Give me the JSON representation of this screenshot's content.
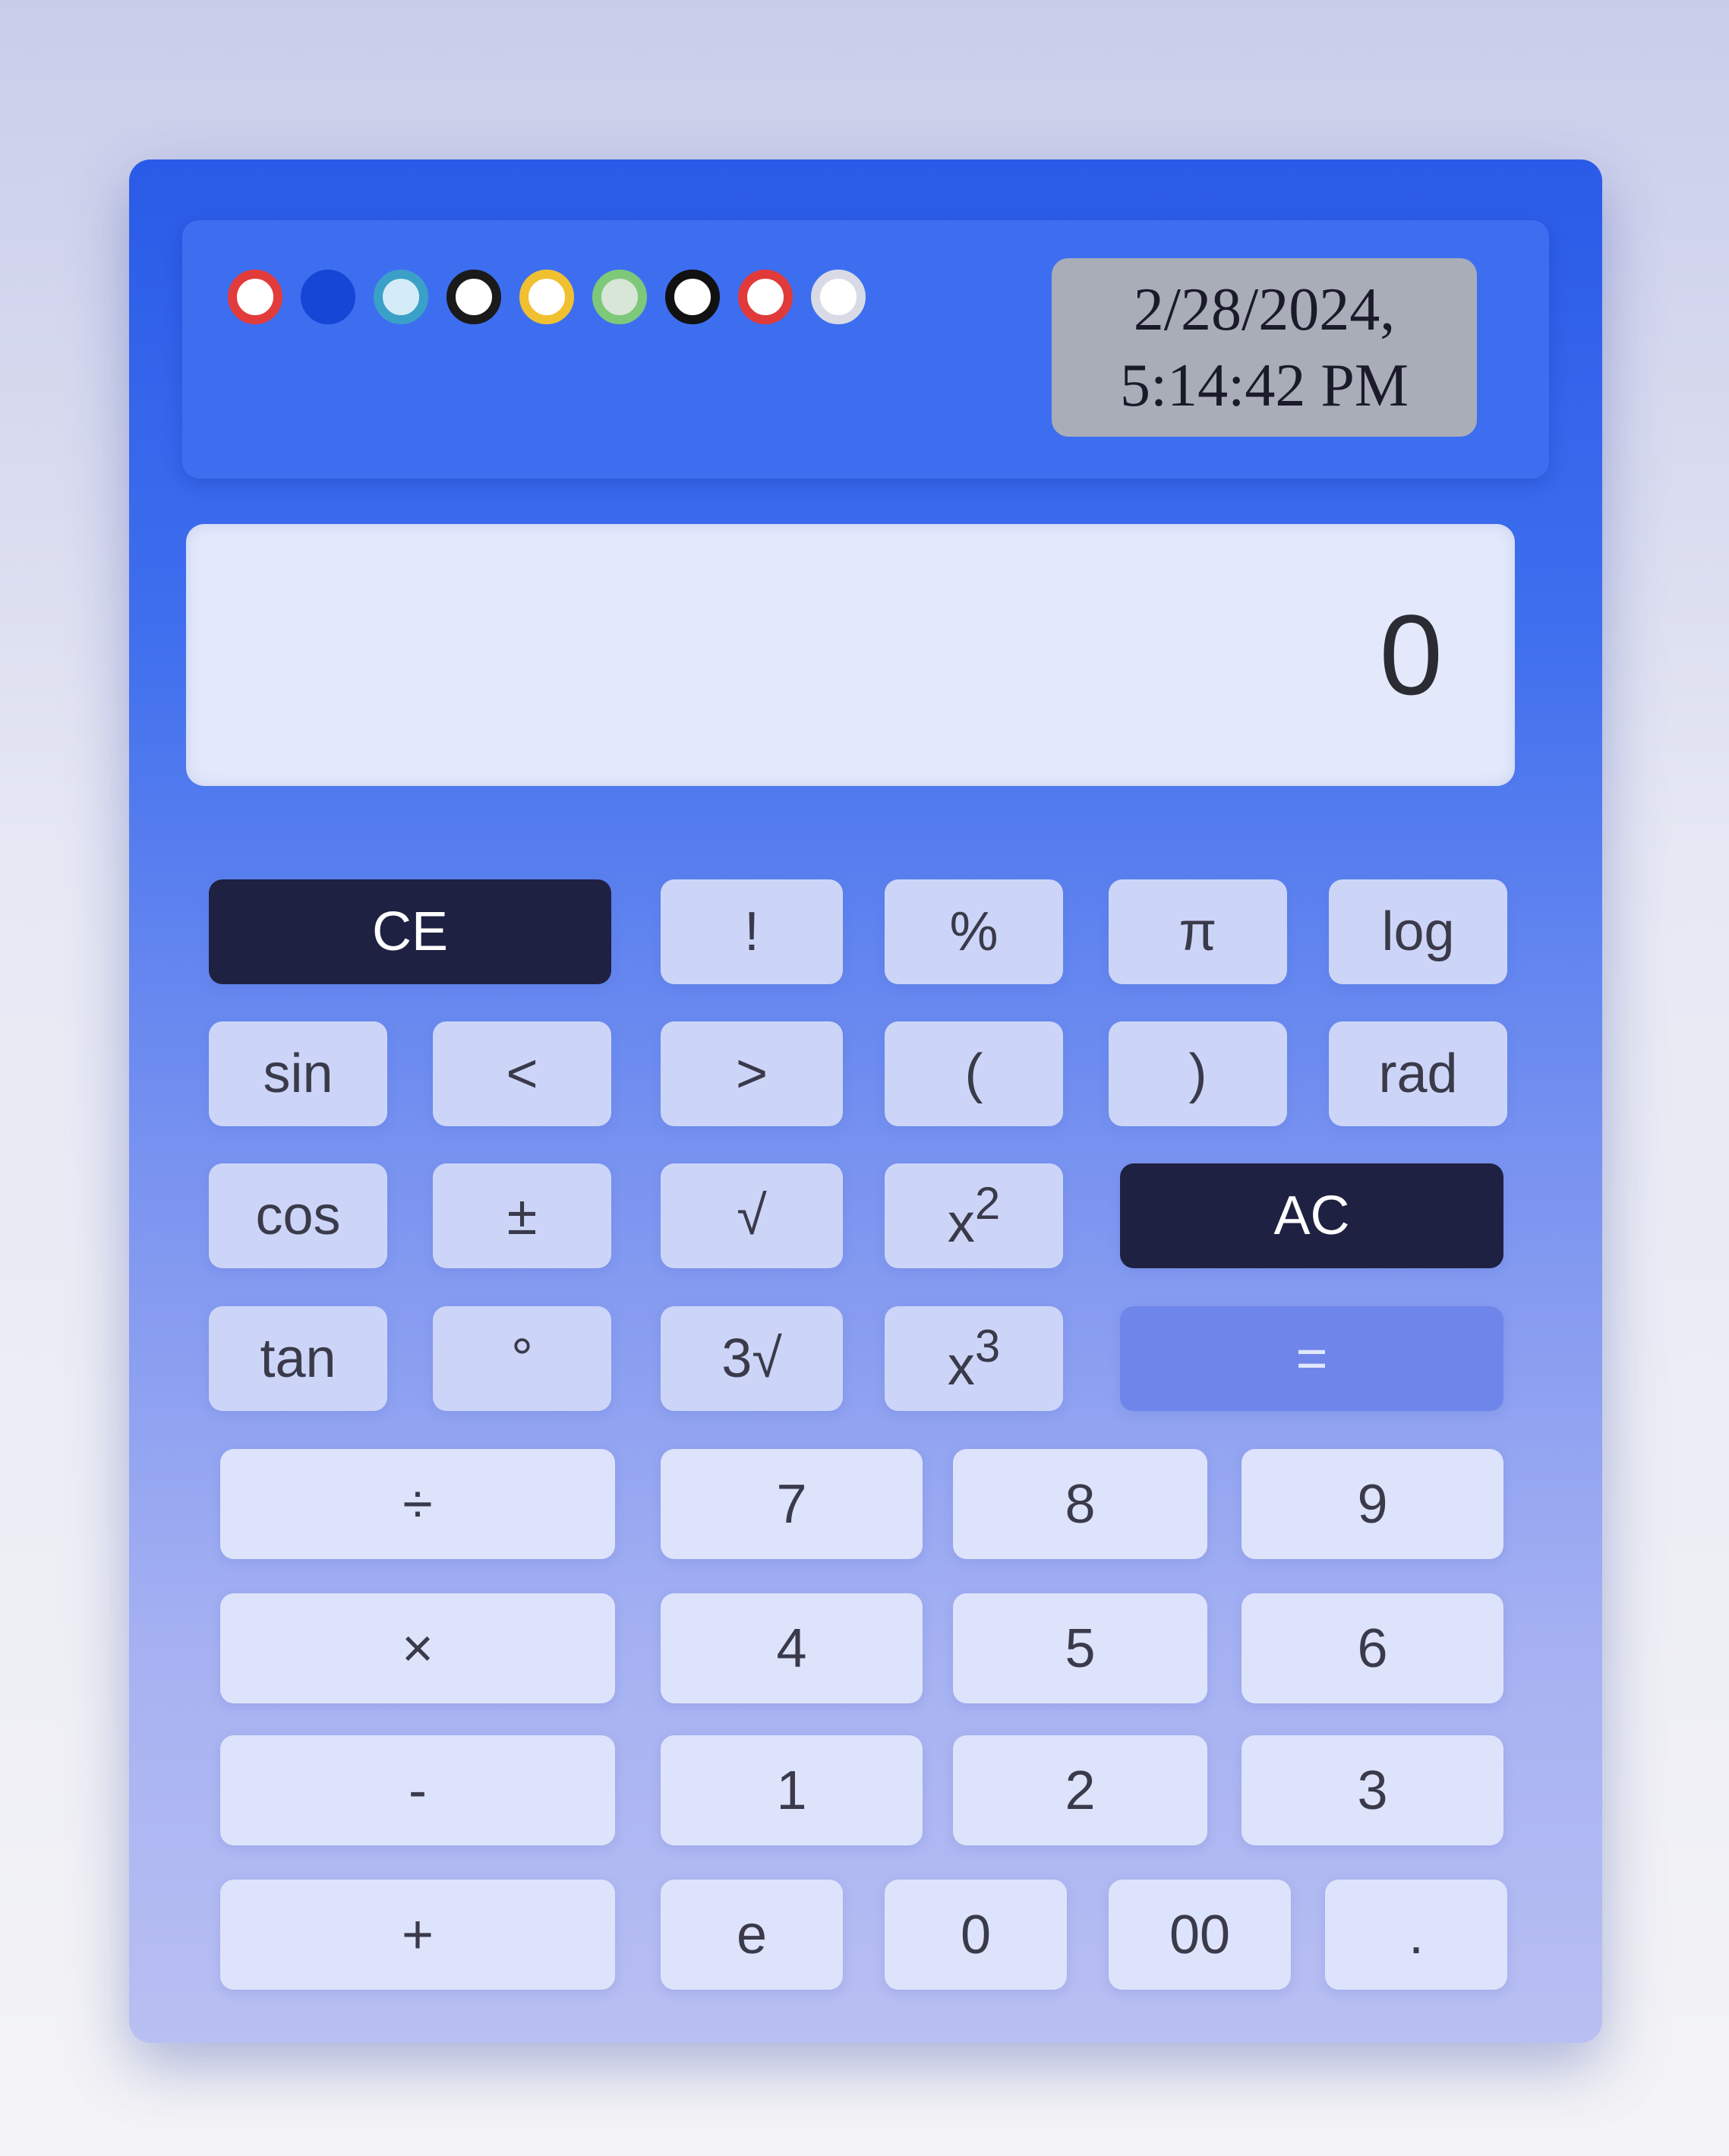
{
  "themes": [
    {
      "name": "red",
      "ring": "#e23b3b",
      "fill": "#ffffff"
    },
    {
      "name": "blue",
      "ring": "#1546d6",
      "fill": "#1546d6"
    },
    {
      "name": "teal",
      "ring": "#3aa0c8",
      "fill": "#d4ecf7"
    },
    {
      "name": "black",
      "ring": "#1a1a1a",
      "fill": "#ffffff"
    },
    {
      "name": "yellow",
      "ring": "#f0c030",
      "fill": "#ffffff"
    },
    {
      "name": "green",
      "ring": "#7ec87a",
      "fill": "#d8e6d8"
    },
    {
      "name": "black-white",
      "ring": "#111111",
      "fill": "#ffffff"
    },
    {
      "name": "red-white",
      "ring": "#e03a3a",
      "fill": "#ffffff"
    },
    {
      "name": "grey",
      "ring": "#d8dbe6",
      "fill": "#ffffff"
    }
  ],
  "clock": {
    "date": "2/28/2024,",
    "time": "5:14:42 PM"
  },
  "display": {
    "value": "0"
  },
  "keys": {
    "ce": "CE",
    "factorial": "!",
    "percent": "%",
    "pi": "π",
    "log": "log",
    "sin": "sin",
    "lt": "<",
    "gt": ">",
    "lparen": "(",
    "rparen": ")",
    "rad": "rad",
    "cos": "cos",
    "plusminus": "±",
    "sqrt": "√",
    "square_base": "x",
    "square_exp": "2",
    "ac": "AC",
    "tan": "tan",
    "degree": "°",
    "cbrt": "3√",
    "cube_base": "x",
    "cube_exp": "3",
    "equals": "=",
    "divide": "÷",
    "seven": "7",
    "eight": "8",
    "nine": "9",
    "multiply": "×",
    "four": "4",
    "five": "5",
    "six": "6",
    "minus": "-",
    "one": "1",
    "two": "2",
    "three": "3",
    "plus": "+",
    "e": "e",
    "zero": "0",
    "double_zero": "00",
    "dot": "."
  },
  "colors": {
    "frame": "#3d6ef0",
    "dark_key": "#1f2142",
    "equals_key": "#6e86ea",
    "key": "#ccd5f8"
  }
}
